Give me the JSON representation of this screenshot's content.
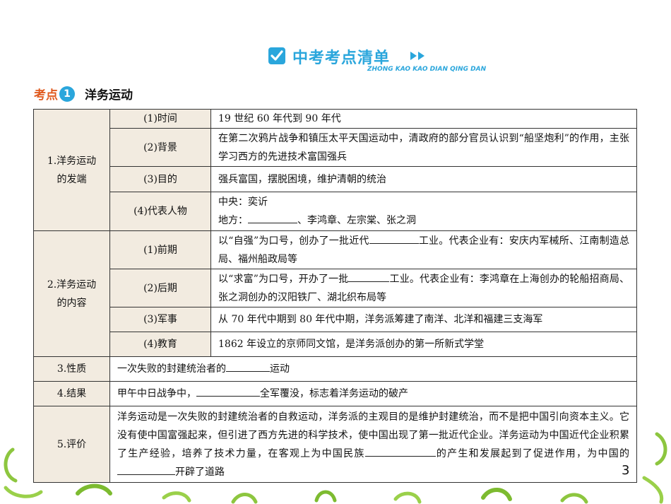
{
  "header": {
    "title": "中考考点清单",
    "pinyin": "ZHONG KAO KAO DIAN QING DAN"
  },
  "section": {
    "label": "考点",
    "number": "1",
    "title": "洋务运动"
  },
  "table": {
    "c1": {
      "cat": "1.洋务运动的发端",
      "r1_sub": "(1)时间",
      "r1_text": "19 世纪 60 年代到 90 年代",
      "r2_sub": "(2)背景",
      "r2_text": "在第二次鸦片战争和镇压太平天国运动中，清政府的部分官员认识到“船坚炮利”的作用，主张学习西方的先进技术富国强兵",
      "r3_sub": "(3)目的",
      "r3_text": "强兵富国，摆脱困境，维护清朝的统治",
      "r4_sub": "(4)代表人物",
      "r4_line1": "中央：奕䜣",
      "r4_line2_pre": "地方：",
      "r4_line2_post": "、李鸿章、左宗棠、张之洞"
    },
    "c2": {
      "cat": "2.洋务运动的内容",
      "r1_sub": "(1)前期",
      "r1_pre": "以“自强”为口号，创办了一批近代",
      "r1_post": "工业。代表企业有：安庆内军械所、江南制造总局、福州船政局等",
      "r2_sub": "(2)后期",
      "r2_pre": "以“求富”为口号，开办了一批",
      "r2_post": "工业。代表企业有：李鸿章在上海创办的轮船招商局、张之洞创办的汉阳铁厂、湖北织布局等",
      "r3_sub": "(3)军事",
      "r3_text": "从 70 年代中期到 80 年代中期，洋务派筹建了南洋、北洋和福建三支海军",
      "r4_sub": "(4)教育",
      "r4_text": "1862 年设立的京师同文馆，是洋务派创办的第一所新式学堂"
    },
    "c3": {
      "cat": "3.性质",
      "pre": "一次失败的封建统治者的",
      "post": "运动"
    },
    "c4": {
      "cat": "4.结果",
      "pre": "甲午中日战争中，",
      "post": "全军覆没，标志着洋务运动的破产"
    },
    "c5": {
      "cat": "5.评价",
      "text_a": "洋务运动是一次失败的封建统治者的自救运动，洋务派的主观目的是维护封建统治，而不是把中国引向资本主义。它没有使中国富强起来，但引进了西方先进的科学技术，使中国出现了第一批近代企业。洋务运动为中国近代企业积累了生产经验，培养了技术力量，在客观上为中国民族",
      "text_b": "的产生和发展起到了促进作用，为中国的",
      "text_c": "开辟了道路"
    }
  },
  "page_number": "3",
  "colors": {
    "accent": "#2aa6dc",
    "label": "#e05a1f",
    "cell_bg": "#f2ebe0"
  }
}
